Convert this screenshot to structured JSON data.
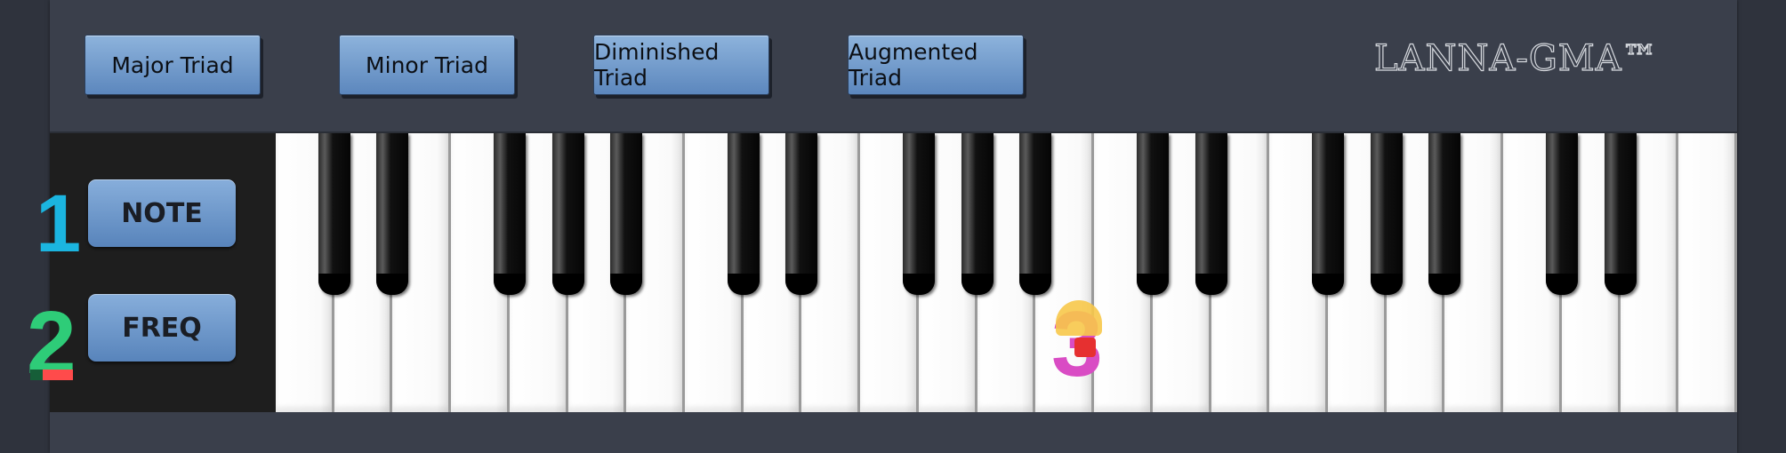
{
  "triad_buttons": [
    {
      "label": "Major Triad"
    },
    {
      "label": "Minor Triad"
    },
    {
      "label": "Diminished Triad"
    },
    {
      "label": "Augmented Triad"
    }
  ],
  "brand": "LANNA-GMA™",
  "side_buttons": {
    "note": "NOTE",
    "freq": "FREQ"
  },
  "markers": {
    "one": "1",
    "two": "2",
    "three": "3"
  },
  "keyboard": {
    "white_keys": 25,
    "black_key_pattern": "C# D# F# G# A# repeating"
  },
  "colors": {
    "marker_one": "#1bb5e0",
    "marker_two": "#2ecc78",
    "marker_three": "#d94cc4",
    "button_top": "#8db3dc",
    "button_bottom": "#5c87bd"
  }
}
